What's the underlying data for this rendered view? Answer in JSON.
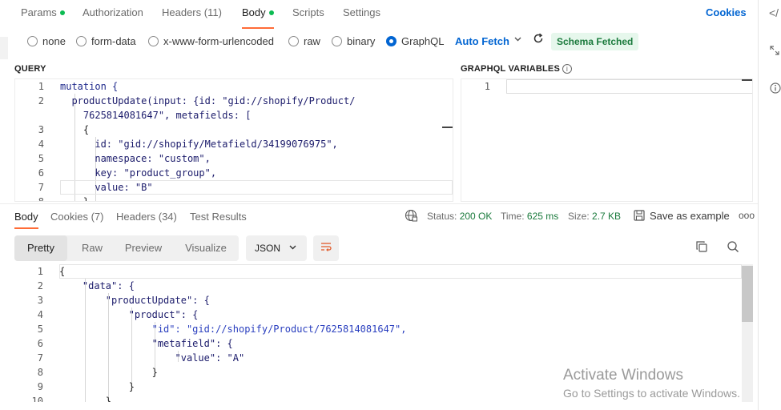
{
  "request_tabs": [
    {
      "label": "Params",
      "dot": true
    },
    {
      "label": "Authorization"
    },
    {
      "label": "Headers (11)"
    },
    {
      "label": "Body",
      "dot": true,
      "active": true
    },
    {
      "label": "Scripts"
    },
    {
      "label": "Settings"
    }
  ],
  "cookies_link": "Cookies",
  "body_types": [
    {
      "label": "none",
      "selected": false
    },
    {
      "label": "form-data",
      "selected": false
    },
    {
      "label": "x-www-form-urlencoded",
      "selected": false
    },
    {
      "label": "raw",
      "selected": false
    },
    {
      "label": "binary",
      "selected": false
    },
    {
      "label": "GraphQL",
      "selected": true
    }
  ],
  "auto_fetch": "Auto Fetch",
  "schema_status": "Schema Fetched",
  "query": {
    "heading": "QUERY",
    "line_numbers": [
      "1",
      "2",
      "",
      "3",
      "4",
      "5",
      "6",
      "7",
      "8"
    ],
    "lines": [
      "mutation {",
      "  productUpdate(input: {id: \"gid://shopify/Product/",
      "    7625814081647\", metafields: [",
      "    {",
      "      id: \"gid://shopify/Metafield/34199076975\",",
      "      namespace: \"custom\",",
      "      key: \"product_group\",",
      "      value: \"B\"",
      "    }"
    ]
  },
  "variables": {
    "heading": "GRAPHQL VARIABLES",
    "line_numbers": [
      "1"
    ]
  },
  "response_tabs": [
    {
      "label": "Body",
      "active": true
    },
    {
      "label": "Cookies (7)"
    },
    {
      "label": "Headers (34)"
    },
    {
      "label": "Test Results"
    }
  ],
  "status": {
    "label": "Status:",
    "value": "200 OK"
  },
  "time": {
    "label": "Time:",
    "value": "625 ms"
  },
  "size": {
    "label": "Size:",
    "value": "2.7 KB"
  },
  "save_example": "Save as example",
  "more": "ooo",
  "view_modes": [
    {
      "label": "Pretty",
      "active": true
    },
    {
      "label": "Raw"
    },
    {
      "label": "Preview"
    },
    {
      "label": "Visualize"
    }
  ],
  "format_select": "JSON",
  "response": {
    "line_numbers": [
      "1",
      "2",
      "3",
      "4",
      "5",
      "6",
      "7",
      "8",
      "9",
      "10"
    ],
    "lines": [
      "{",
      "    \"data\": {",
      "        \"productUpdate\": {",
      "            \"product\": {",
      "                \"id\": \"gid://shopify/Product/7625814081647\",",
      "                \"metafield\": {",
      "                    \"value\": \"A\"",
      "                }",
      "            }",
      "        }"
    ]
  },
  "watermark": {
    "title": "Activate Windows",
    "subtitle": "Go to Settings to activate Windows."
  },
  "icons": [
    "code-icon",
    "expand-icon",
    "info-icon",
    "globe-icon",
    "save-icon",
    "copy-icon",
    "search-icon",
    "wrap-icon",
    "refresh-icon",
    "chevron-down-icon"
  ]
}
